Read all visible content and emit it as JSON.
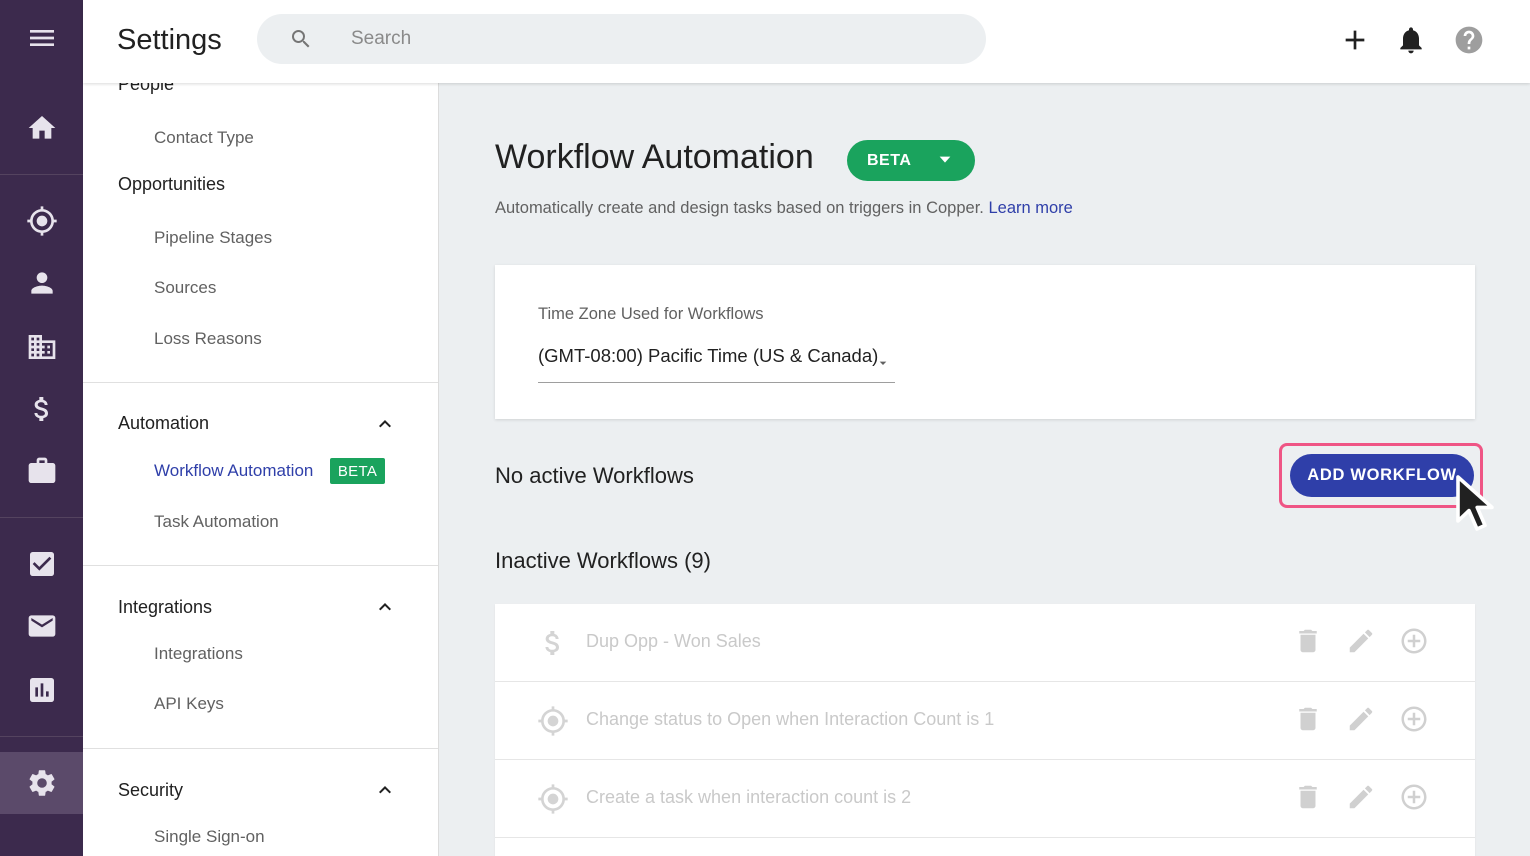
{
  "app": {
    "title": "Settings"
  },
  "search": {
    "placeholder": "Search"
  },
  "rail": {
    "icons": [
      "menu-icon",
      "home-icon",
      "target-icon",
      "person-icon",
      "building-icon",
      "dollar-icon",
      "briefcase-icon",
      "checkbox-icon",
      "mail-icon",
      "chart-icon",
      "gear-icon"
    ],
    "active": "gear-icon"
  },
  "topbar_icons": [
    "plus-icon",
    "bell-icon",
    "help-icon"
  ],
  "settings_nav": {
    "partial_heading": "People",
    "people_items": [
      "Contact Type"
    ],
    "opportunities": {
      "label": "Opportunities",
      "items": [
        "Pipeline Stages",
        "Sources",
        "Loss Reasons"
      ]
    },
    "automation": {
      "label": "Automation",
      "items": [
        "Workflow Automation",
        "Task Automation"
      ],
      "badge": "BETA",
      "selected": "Workflow Automation"
    },
    "integrations": {
      "label": "Integrations",
      "items": [
        "Integrations",
        "API Keys"
      ]
    },
    "security": {
      "label": "Security",
      "items": [
        "Single Sign-on"
      ]
    }
  },
  "main": {
    "title": "Workflow Automation",
    "beta_label": "BETA",
    "subtitle": "Automatically create and design tasks based on triggers in Copper.",
    "learn_more": "Learn more",
    "timezone": {
      "label": "Time Zone Used for Workflows",
      "value": "(GMT-08:00) Pacific Time (US & Canada)"
    },
    "no_active": "No active Workflows",
    "add_button": "ADD WORKFLOW",
    "inactive_heading": "Inactive Workflows (9)",
    "workflows": [
      {
        "icon": "dollar-icon",
        "name": "Dup Opp - Won Sales"
      },
      {
        "icon": "target-icon",
        "name": "Change status to Open when Interaction Count is 1"
      },
      {
        "icon": "target-icon",
        "name": "Create a task when interaction count is 2"
      }
    ],
    "row_actions": [
      "trash-icon",
      "edit-icon",
      "add-circle-icon"
    ]
  },
  "colors": {
    "rail_bg": "#3c2a4d",
    "accent": "#2f3fa9",
    "beta_green": "#1aa35d",
    "highlight": "#ef5585"
  }
}
